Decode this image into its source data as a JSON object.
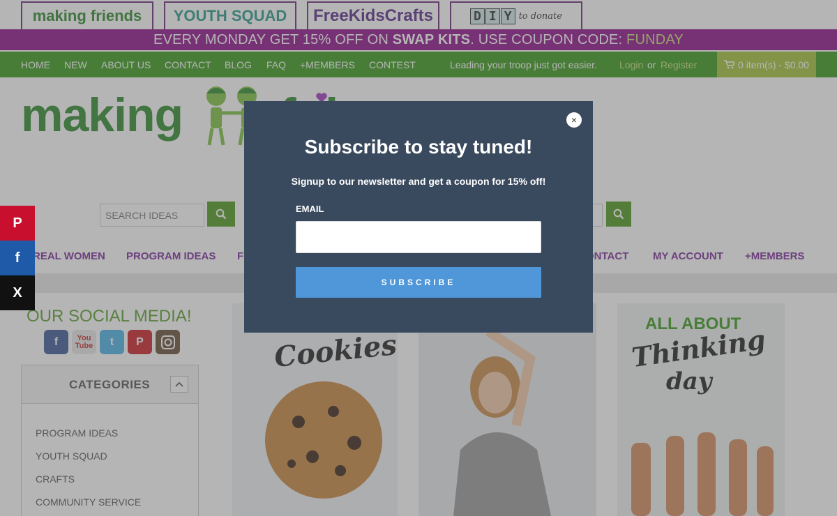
{
  "logos": {
    "making_friends": "making friends",
    "youth_squad": "YOUTH SQUAD",
    "free_kids_crafts": "FreeKidsCrafts",
    "diy_letters": [
      "D",
      "I",
      "Y"
    ],
    "diy_tail": "to donate"
  },
  "promo": {
    "prefix": "EVERY MONDAY GET 15% OFF ON ",
    "highlight": "SWAP KITS",
    "middle": ". USE COUPON CODE: ",
    "code": "FUNDAY"
  },
  "nav": {
    "items": [
      "HOME",
      "NEW",
      "ABOUT US",
      "CONTACT",
      "BLOG",
      "FAQ",
      "+MEMBERS",
      "CONTEST"
    ],
    "tagline": "Leading your troop just got easier.",
    "login": "Login",
    "or": "or",
    "register": "Register",
    "cart": "0 item(s) - $0.00"
  },
  "big_logo": {
    "part1": "making",
    "part2": "f   d"
  },
  "search": {
    "placeholder": "SEARCH IDEAS"
  },
  "main_menu": {
    "items": [
      "REAL WOMEN",
      "PROGRAM IDEAS",
      "F",
      "ONTACT",
      "MY ACCOUNT",
      "+MEMBERS"
    ]
  },
  "share": {
    "pinterest": "P",
    "facebook": "f",
    "x": "X"
  },
  "social": {
    "title": "OUR SOCIAL MEDIA!"
  },
  "categories": {
    "title": "CATEGORIES",
    "items": [
      "PROGRAM IDEAS",
      "YOUTH SQUAD",
      "CRAFTS",
      "COMMUNITY SERVICE"
    ]
  },
  "cards": {
    "cookies": "Cookies",
    "thinking_top": "ALL ABOUT",
    "thinking_line1": "Thinking",
    "thinking_line2": "day"
  },
  "modal": {
    "title": "Subscribe to stay tuned!",
    "subtitle": "Signup to our newsletter and get a coupon for 15% off!",
    "email_label": "EMAIL",
    "email_value": "",
    "button": "SUBSCRIBE",
    "close": "×"
  },
  "colors": {
    "promo_bg": "#8e0f8a",
    "nav_bg": "#3a9a1d",
    "cart_bg": "#a4c43a",
    "menu_text": "#7a2b9a",
    "modal_bg": "#3a4a5e",
    "subscribe_btn": "#4f97d8"
  }
}
